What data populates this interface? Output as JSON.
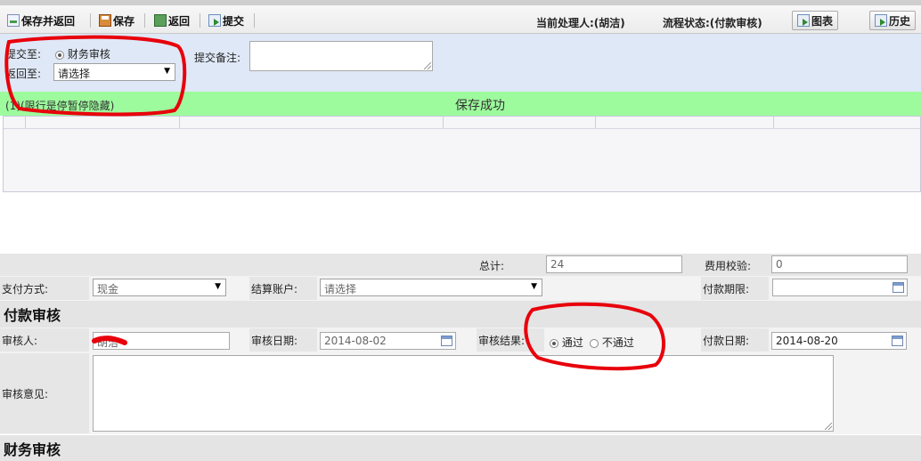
{
  "toolbar": {
    "save_return": "保存并返回",
    "save": "保存",
    "back": "返回",
    "submit": "提交",
    "handler": "当前处理人:(胡洁)",
    "flow_status": "流程状态:(付款审核)",
    "chart": "图表",
    "history": "历史"
  },
  "submit_panel": {
    "submit_to_label": "提交至:",
    "submit_to_option": "财务审核",
    "return_to_label": "返回至:",
    "return_to_value": "请选择",
    "remark_label": "提交备注:",
    "remark_value": ""
  },
  "success_bar": {
    "left_text": "(1)(限行是停暂停隐藏)",
    "message": "保存成功"
  },
  "totals": {
    "total_label": "总计:",
    "total_value": "24",
    "fee_check_label": "费用校验:",
    "fee_check_value": "0"
  },
  "payment": {
    "method_label": "支付方式:",
    "method_value": "现金",
    "account_label": "结算账户:",
    "account_value": "请选择",
    "deadline_label": "付款期限:",
    "deadline_value": ""
  },
  "payment_review": {
    "title": "付款审核",
    "reviewer_label": "审核人:",
    "reviewer_value": "胡洁",
    "review_date_label": "审核日期:",
    "review_date_value": "2014-08-02",
    "result_label": "审核结果:",
    "result_pass": "通过",
    "result_fail": "不通过",
    "pay_date_label": "付款日期:",
    "pay_date_value": "2014-08-20",
    "opinion_label": "审核意见:",
    "opinion_value": ""
  },
  "finance_review": {
    "title": "财务审核"
  },
  "colors": {
    "success_bg": "#9dfb9d",
    "panel_bg": "#dfe8f6",
    "annotation": "#e8000b"
  }
}
